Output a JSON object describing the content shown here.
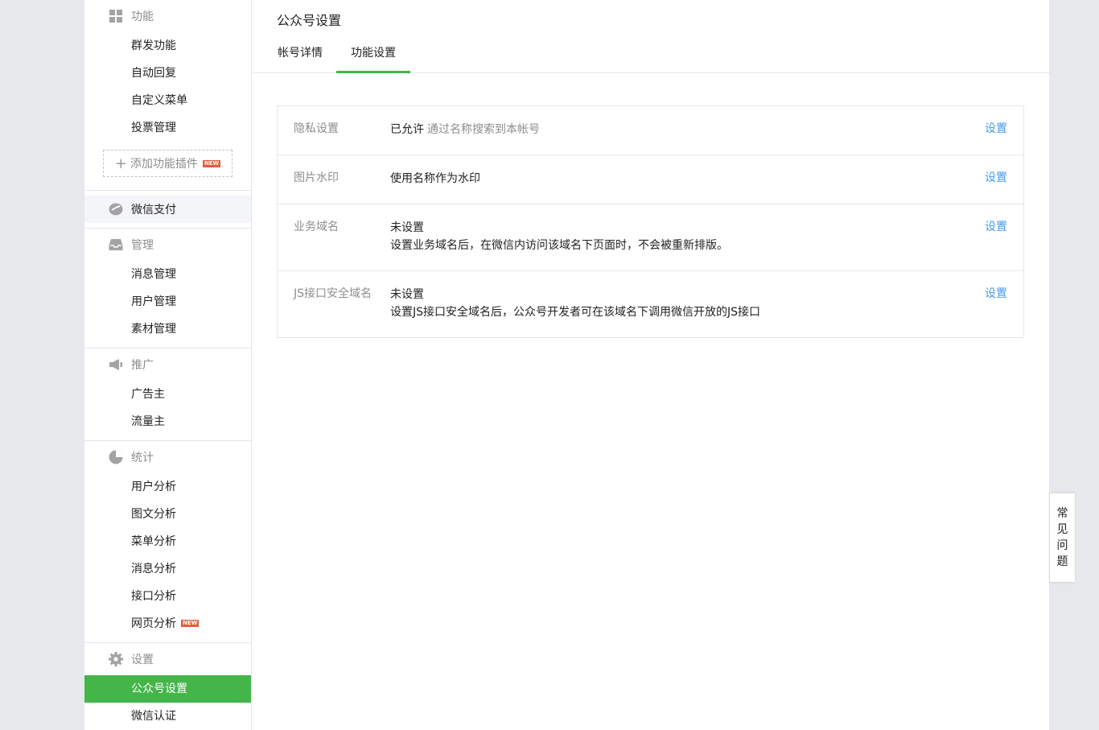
{
  "sidebar": {
    "features": {
      "title": "功能",
      "icon": "grid-icon",
      "items": [
        "群发功能",
        "自动回复",
        "自定义菜单",
        "投票管理"
      ],
      "add_plugin": "添加功能插件",
      "new_badge": "NEW"
    },
    "wechat_pay": {
      "label": "微信支付",
      "icon": "wallet-icon"
    },
    "manage": {
      "title": "管理",
      "icon": "inbox-icon",
      "items": [
        "消息管理",
        "用户管理",
        "素材管理"
      ]
    },
    "promote": {
      "title": "推广",
      "icon": "megaphone-icon",
      "items": [
        "广告主",
        "流量主"
      ]
    },
    "stats": {
      "title": "统计",
      "icon": "pie-chart-icon",
      "items": [
        "用户分析",
        "图文分析",
        "菜单分析",
        "消息分析",
        "接口分析",
        "网页分析"
      ],
      "new_badge": "NEW"
    },
    "settings": {
      "title": "设置",
      "icon": "gear-icon",
      "items": [
        "公众号设置",
        "微信认证"
      ]
    }
  },
  "main": {
    "page_title": "公众号设置",
    "tabs": [
      {
        "label": "帐号详情"
      },
      {
        "label": "功能设置"
      }
    ],
    "rows": [
      {
        "label": "隐私设置",
        "value": "已允许",
        "sub": "通过名称搜索到本帐号",
        "action": "设置"
      },
      {
        "label": "图片水印",
        "value": "使用名称作为水印",
        "action": "设置"
      },
      {
        "label": "业务域名",
        "value": "未设置",
        "desc": "设置业务域名后，在微信内访问该域名下页面时，不会被重新排版。",
        "action": "设置"
      },
      {
        "label": "JS接口安全域名",
        "value": "未设置",
        "desc": "设置JS接口安全域名后，公众号开发者可在该域名下调用微信开放的JS接口",
        "action": "设置"
      }
    ]
  },
  "faq": {
    "chars": [
      "常",
      "见",
      "问",
      "题"
    ]
  },
  "colors": {
    "accent": "#44b549",
    "link": "#459ae9",
    "badge": "#e15f3a"
  }
}
